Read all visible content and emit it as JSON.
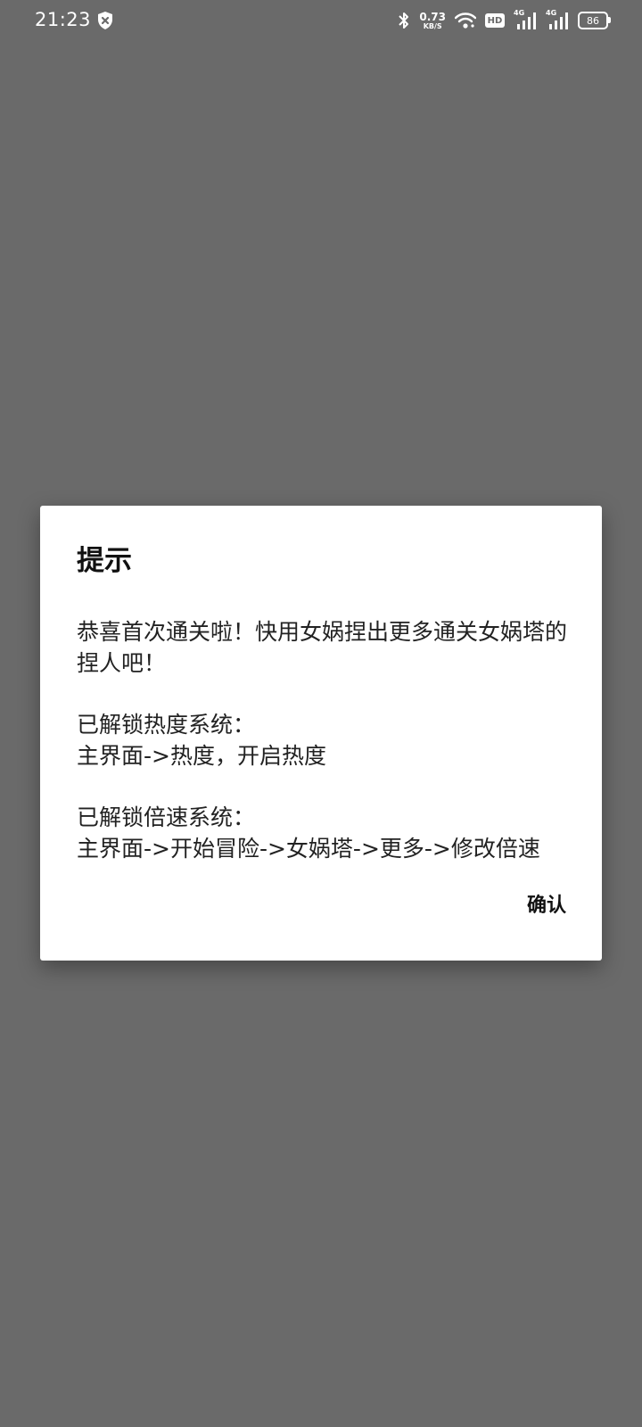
{
  "status_bar": {
    "time": "21:23",
    "network_speed_value": "0.73",
    "network_speed_unit": "KB/S",
    "hd_badge": "HD",
    "sim1_label": "4G",
    "sim2_label": "4G",
    "battery_level": "86",
    "icons": [
      "shield-icon",
      "bluetooth-icon",
      "wifi-icon",
      "signal-icon",
      "signal-icon",
      "battery-icon"
    ]
  },
  "dialog": {
    "title": "提示",
    "message_lines": [
      "恭喜首次通关啦！快用女娲捏出更多通关女娲塔的捏人吧！",
      "已解锁热度系统：",
      "主界面->热度，开启热度",
      "已解锁倍速系统：",
      "主界面->开始冒险->女娲塔->更多->修改倍速"
    ],
    "confirm_label": "确认"
  },
  "colors": {
    "backdrop": "#6a6a6a",
    "dialog_bg": "#ffffff",
    "text": "#111111"
  }
}
